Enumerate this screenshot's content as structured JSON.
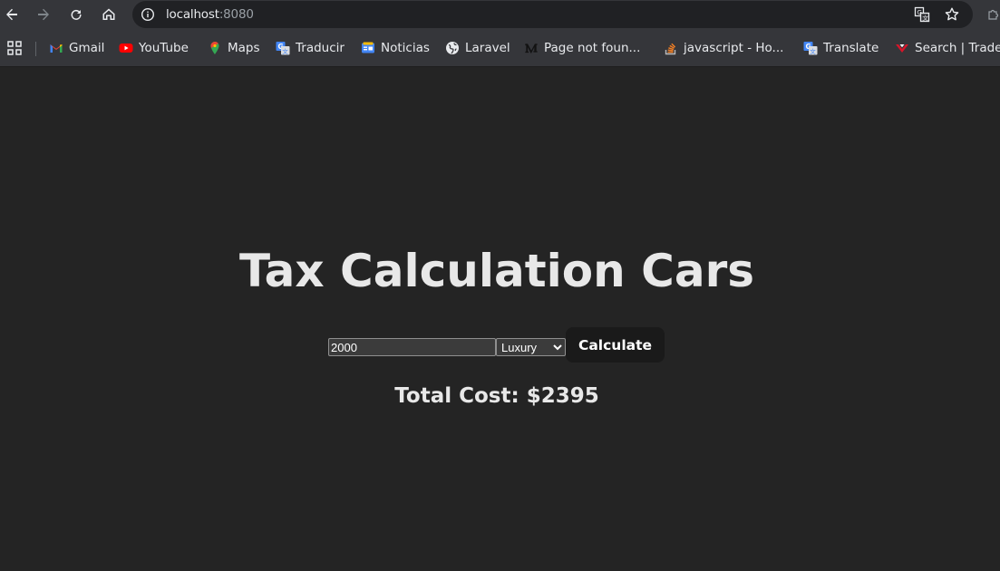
{
  "browser": {
    "url_host": "localhost",
    "url_port": ":8080",
    "bookmarks": [
      {
        "label": "Gmail",
        "icon": "gmail-icon"
      },
      {
        "label": "YouTube",
        "icon": "youtube-icon"
      },
      {
        "label": "Maps",
        "icon": "maps-icon"
      },
      {
        "label": "Traducir",
        "icon": "google-translate-icon"
      },
      {
        "label": "Noticias",
        "icon": "google-news-icon"
      },
      {
        "label": "Laravel",
        "icon": "globe-icon"
      },
      {
        "label": "Page not foun...",
        "icon": "medium-icon"
      },
      {
        "label": "javascript - Ho...",
        "icon": "stackoverflow-icon"
      },
      {
        "label": "Translate",
        "icon": "google-translate-icon"
      },
      {
        "label": "Search | Trade",
        "icon": "trade-icon"
      }
    ]
  },
  "app": {
    "title": "Tax Calculation Cars",
    "amount_value": "2000",
    "selected_type": "Luxury",
    "calculate_label": "Calculate",
    "total_text": "Total Cost: $2395"
  },
  "colors": {
    "page_background": "#242424",
    "button_background": "#1a1a1a",
    "text": "#e8e8e8"
  }
}
